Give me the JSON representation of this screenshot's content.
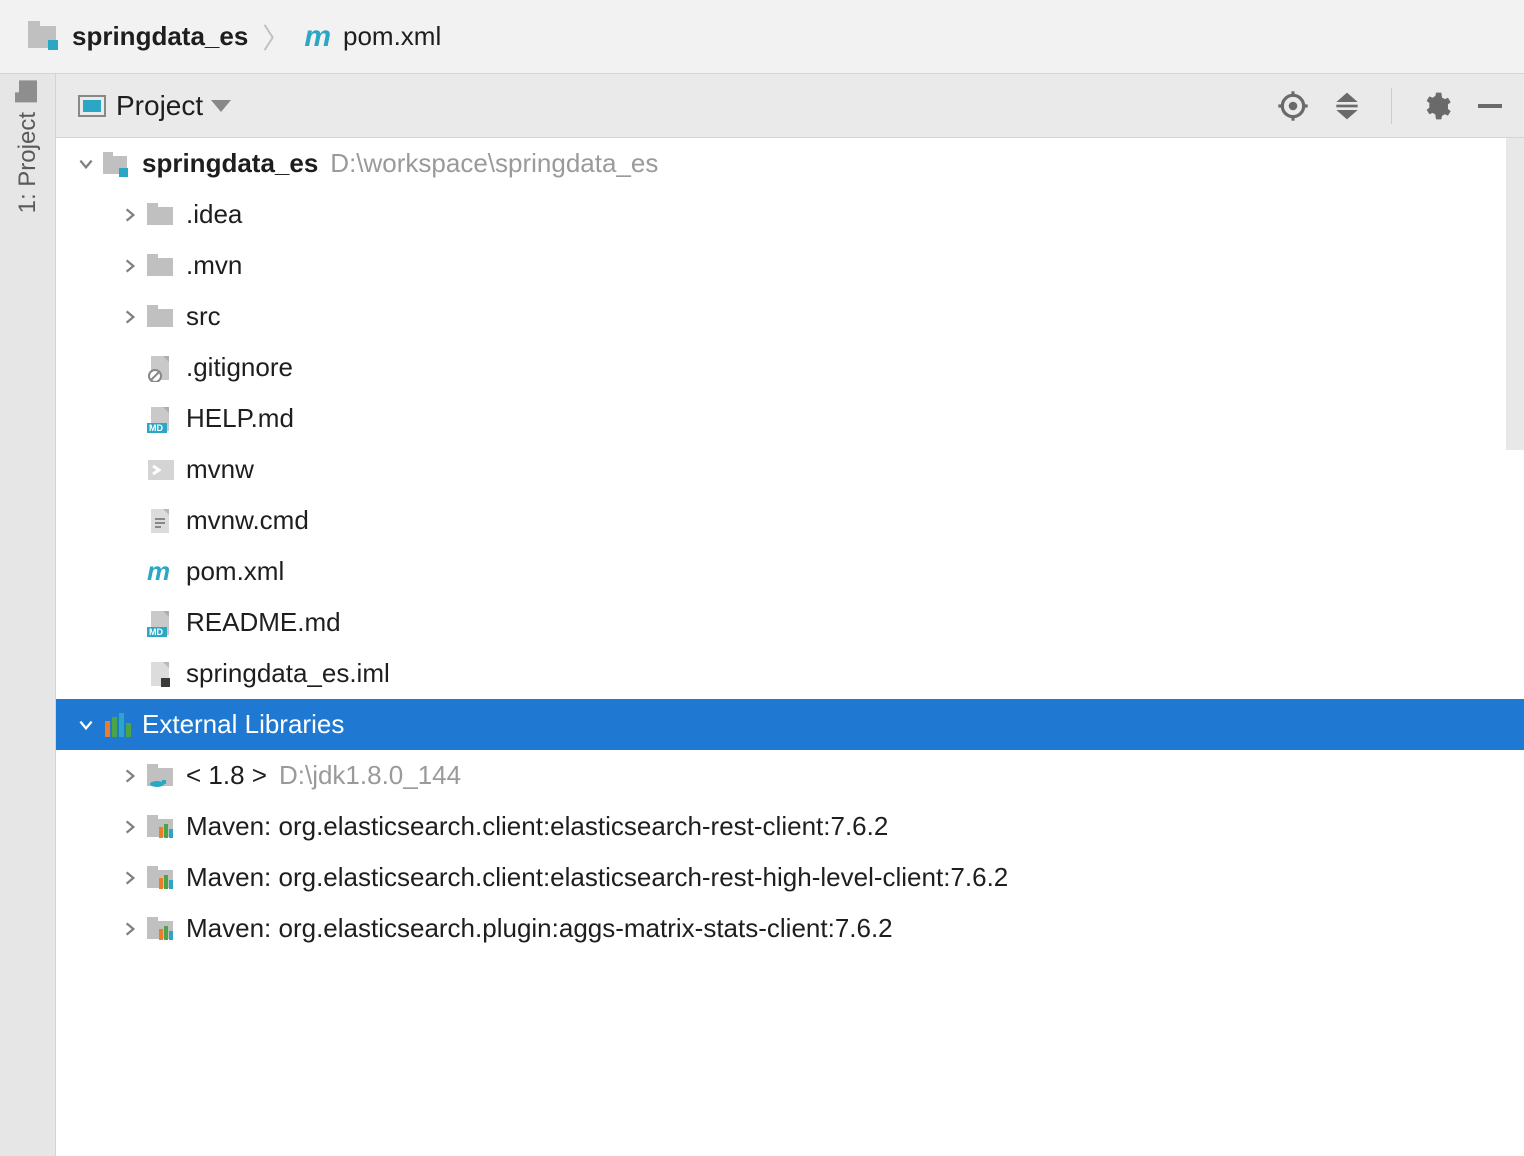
{
  "breadcrumb": {
    "project": "springdata_es",
    "file": "pom.xml"
  },
  "sidebar": {
    "tab": "1: Project"
  },
  "panel": {
    "title": "Project"
  },
  "tree": {
    "root": {
      "name": "springdata_es",
      "path": "D:\\workspace\\springdata_es"
    },
    "items": [
      {
        "name": ".idea",
        "type": "folder",
        "chev": true
      },
      {
        "name": ".mvn",
        "type": "folder",
        "chev": true
      },
      {
        "name": "src",
        "type": "folder",
        "chev": true
      },
      {
        "name": ".gitignore",
        "type": "ignorefile",
        "chev": false
      },
      {
        "name": "HELP.md",
        "type": "md",
        "chev": false
      },
      {
        "name": "mvnw",
        "type": "sh",
        "chev": false
      },
      {
        "name": "mvnw.cmd",
        "type": "txt",
        "chev": false
      },
      {
        "name": "pom.xml",
        "type": "maven",
        "chev": false
      },
      {
        "name": "README.md",
        "type": "md",
        "chev": false
      },
      {
        "name": "springdata_es.iml",
        "type": "iml",
        "chev": false
      }
    ],
    "extlib": {
      "label": "External Libraries"
    },
    "libs": [
      {
        "name": "< 1.8 >",
        "path": "D:\\jdk1.8.0_144",
        "type": "jdk"
      },
      {
        "name": "Maven: org.elasticsearch.client:elasticsearch-rest-client:7.6.2",
        "type": "lib"
      },
      {
        "name": "Maven: org.elasticsearch.client:elasticsearch-rest-high-level-client:7.6.2",
        "type": "lib"
      },
      {
        "name": "Maven: org.elasticsearch.plugin:aggs-matrix-stats-client:7.6.2",
        "type": "lib"
      }
    ]
  }
}
